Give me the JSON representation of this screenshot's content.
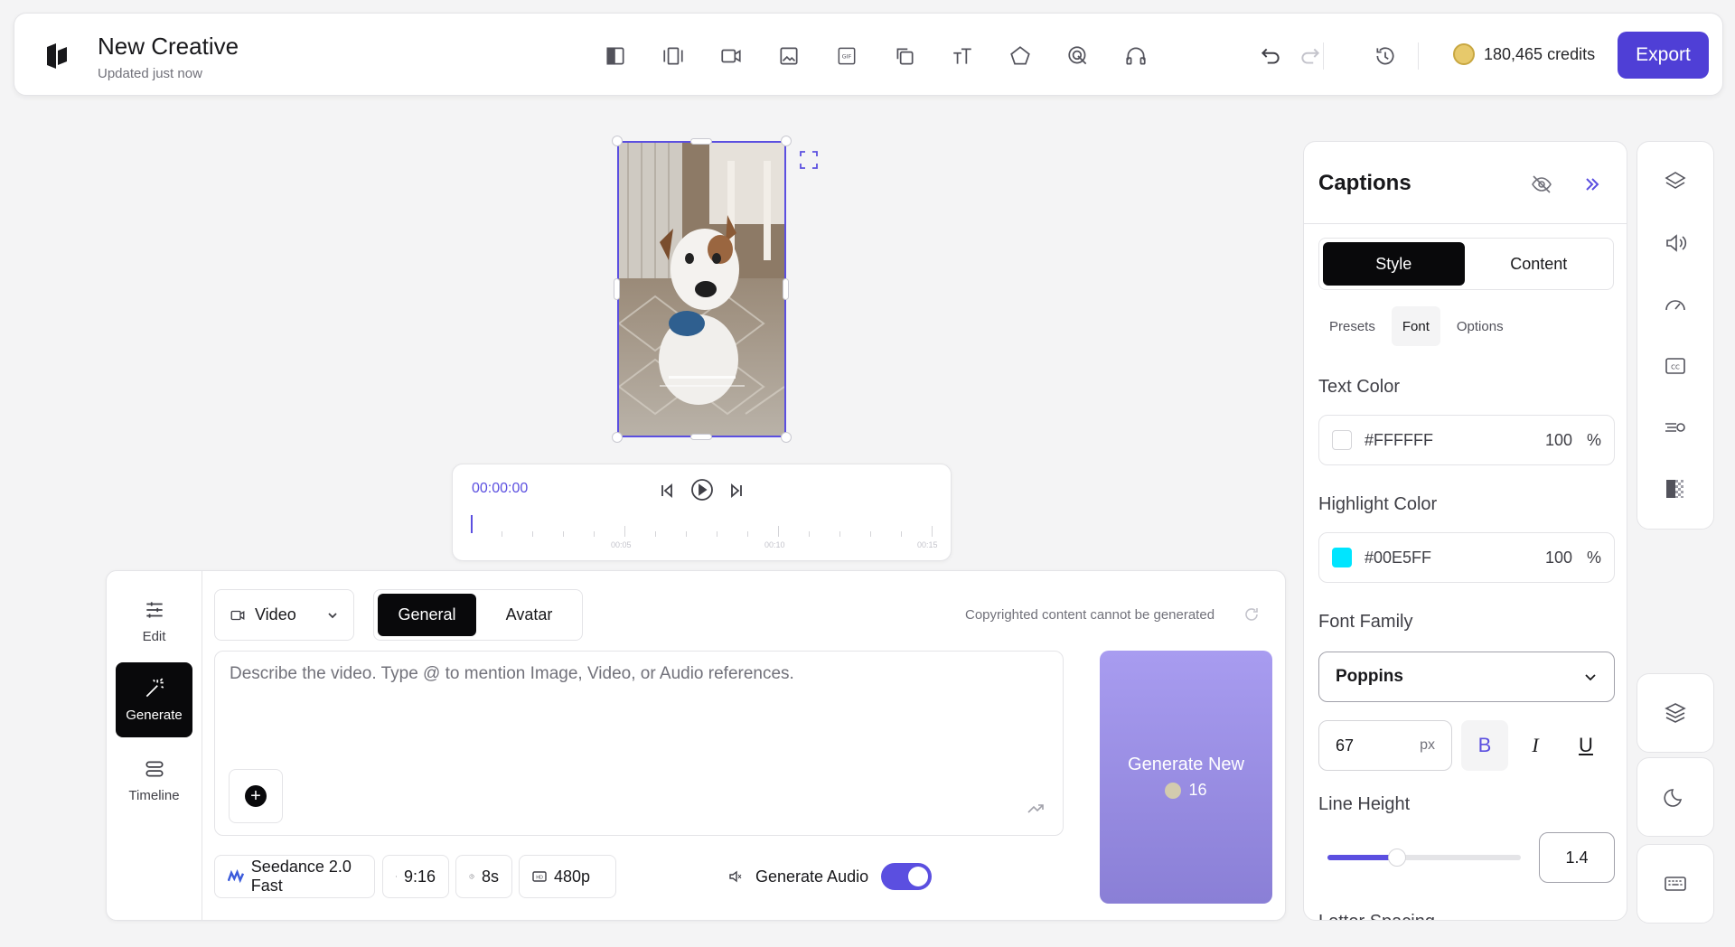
{
  "header": {
    "title": "New Creative",
    "subtitle": "Updated just now",
    "tools": [
      "layout-icon",
      "timeline-scenes-icon",
      "video-icon",
      "image-icon",
      "gif-icon",
      "copy-element-icon",
      "text-icon",
      "shape-icon",
      "cursor-click-icon",
      "audio-icon"
    ],
    "credits": "180,465 credits",
    "export_label": "Export"
  },
  "player": {
    "time": "00:00:00",
    "marks": [
      "00:05",
      "00:10",
      "00:15"
    ]
  },
  "generate_panel": {
    "nav": [
      {
        "label": "Edit",
        "icon": "sliders-icon"
      },
      {
        "label": "Generate",
        "icon": "magic-wand-icon"
      },
      {
        "label": "Timeline",
        "icon": "timeline-icon"
      }
    ],
    "type_select": "Video",
    "tabs": [
      "General",
      "Avatar"
    ],
    "active_tab": "General",
    "note": "Copyrighted content cannot be generated",
    "prompt_placeholder": "Describe the video. Type @ to mention Image, Video, or Audio references.",
    "generate_button": "Generate New",
    "generate_cost": "16",
    "model": "Seedance 2.0 Fast",
    "aspect": "9:16",
    "duration": "8s",
    "resolution": "480p",
    "audio_label": "Generate Audio",
    "audio_enabled": true
  },
  "captions": {
    "title": "Captions",
    "segments": [
      "Style",
      "Content"
    ],
    "active_segment": "Style",
    "subtabs": [
      "Presets",
      "Font",
      "Options"
    ],
    "active_subtab": "Font",
    "text_color_label": "Text Color",
    "text_color": {
      "hex": "#FFFFFF",
      "opacity": "100",
      "unit": "%"
    },
    "highlight_color_label": "Highlight Color",
    "highlight_color": {
      "hex": "#00E5FF",
      "opacity": "100",
      "unit": "%"
    },
    "font_family_label": "Font Family",
    "font_family": "Poppins",
    "font_size": "67",
    "font_size_unit": "px",
    "format_buttons": [
      "B",
      "I",
      "U"
    ],
    "line_height_label": "Line Height",
    "line_height": "1.4",
    "line_height_fraction": 0.36,
    "next_label": "Letter Spacing"
  },
  "right_rail": {
    "icons": [
      "layers-icon",
      "volume-icon",
      "speed-icon",
      "captions-icon",
      "motion-icon",
      "fade-icon"
    ],
    "buttons": [
      "stack-icon",
      "moon-icon",
      "keyboard-icon"
    ]
  }
}
